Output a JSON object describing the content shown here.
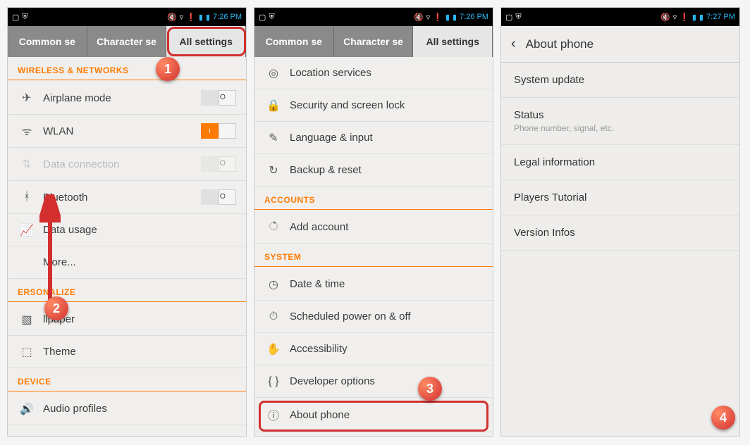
{
  "statusbar": {
    "time1": "7:26 PM",
    "time2": "7:27 PM"
  },
  "tabs": {
    "common": "Common se",
    "character": "Character se",
    "all": "All settings"
  },
  "screen1": {
    "section_wireless": "WIRELESS & NETWORKS",
    "airplane": "Airplane mode",
    "wlan": "WLAN",
    "data": "Data connection",
    "bluetooth": "Bluetooth",
    "usage": "Data usage",
    "more": "More...",
    "section_personalize": "ERSONALIZE",
    "wallpaper": "llpaper",
    "theme": "Theme",
    "section_device": "DEVICE",
    "audio": "Audio profiles"
  },
  "screen2": {
    "location": "Location services",
    "security": "Security and screen lock",
    "language": "Language & input",
    "backup": "Backup & reset",
    "section_accounts": "ACCOUNTS",
    "add_account": "Add account",
    "section_system": "SYSTEM",
    "date": "Date & time",
    "scheduled": "Scheduled power on & off",
    "accessibility": "Accessibility",
    "developer": "Developer options",
    "about": "About phone"
  },
  "screen3": {
    "title": "About phone",
    "system_update": "System update",
    "status": "Status",
    "status_sub": "Phone number, signal, etc.",
    "legal": "Legal information",
    "players": "Players Tutorial",
    "version": "Version Infos"
  },
  "markers": {
    "m1": "1",
    "m2": "2",
    "m3": "3",
    "m4": "4"
  }
}
